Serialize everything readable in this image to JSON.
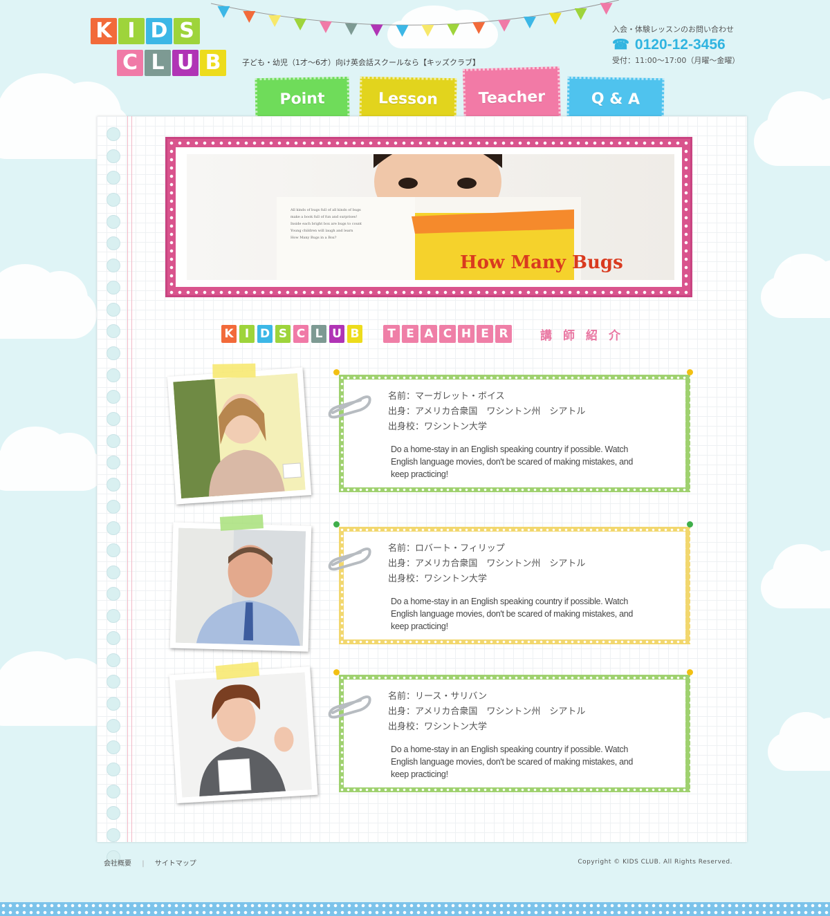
{
  "logo": {
    "row1": [
      "K",
      "I",
      "D",
      "S"
    ],
    "row2": [
      "C",
      "L",
      "U",
      "B"
    ]
  },
  "tagline": "子ども・幼児（1才〜6才）向け英会話スクールなら【キッズクラブ】",
  "contact": {
    "label": "入会・体験レッスンのお問い合わせ",
    "phone": "0120-12-3456",
    "hours": "受付：11:00〜17:00（月曜〜金曜）"
  },
  "nav": [
    {
      "label": "Point",
      "color": "#6fdc5a"
    },
    {
      "label": "Lesson",
      "color": "#e2d41d"
    },
    {
      "label": "Teacher",
      "color": "#f27aa6"
    },
    {
      "label": "Q & A",
      "color": "#4fc3ee"
    }
  ],
  "hero": {
    "book_text": "How Many Bugs"
  },
  "heading": {
    "logo_letters": [
      "K",
      "I",
      "D",
      "S",
      "C",
      "L",
      "U",
      "B"
    ],
    "teacher_letters": [
      "T",
      "E",
      "A",
      "C",
      "H",
      "E",
      "R"
    ],
    "jp": "講師紹介"
  },
  "teachers": [
    {
      "name": "名前：マーガレット・ボイス",
      "origin": "出身：アメリカ合衆国　ワシントン州　シアトル",
      "school": "出身校：ワシントン大学",
      "quote": "Do a home-stay in an English speaking country if possible. Watch English language movies, don't be scared of making mistakes, and keep practicing!",
      "frame_color": "#9fd16f",
      "tape_color": "#f7e86a"
    },
    {
      "name": "名前：ロバート・フィリップ",
      "origin": "出身：アメリカ合衆国　ワシントン州　シアトル",
      "school": "出身校：ワシントン大学",
      "quote": "Do a home-stay in an English speaking country if possible. Watch English language movies, don't be scared of making mistakes, and keep practicing!",
      "frame_color": "#f2d76e",
      "tape_color": "#a8e07a"
    },
    {
      "name": "名前：リース・サリバン",
      "origin": "出身：アメリカ合衆国　ワシントン州　シアトル",
      "school": "出身校：ワシントン大学",
      "quote": "Do a home-stay in an English speaking country if possible. Watch English language movies, don't be scared of making mistakes, and keep practicing!",
      "frame_color": "#9fd16f",
      "tape_color": "#f7e86a"
    }
  ],
  "footer": {
    "links": [
      "会社概要",
      "サイトマップ"
    ],
    "copyright": "Copyright © KIDS CLUB. All Rights Reserved."
  }
}
